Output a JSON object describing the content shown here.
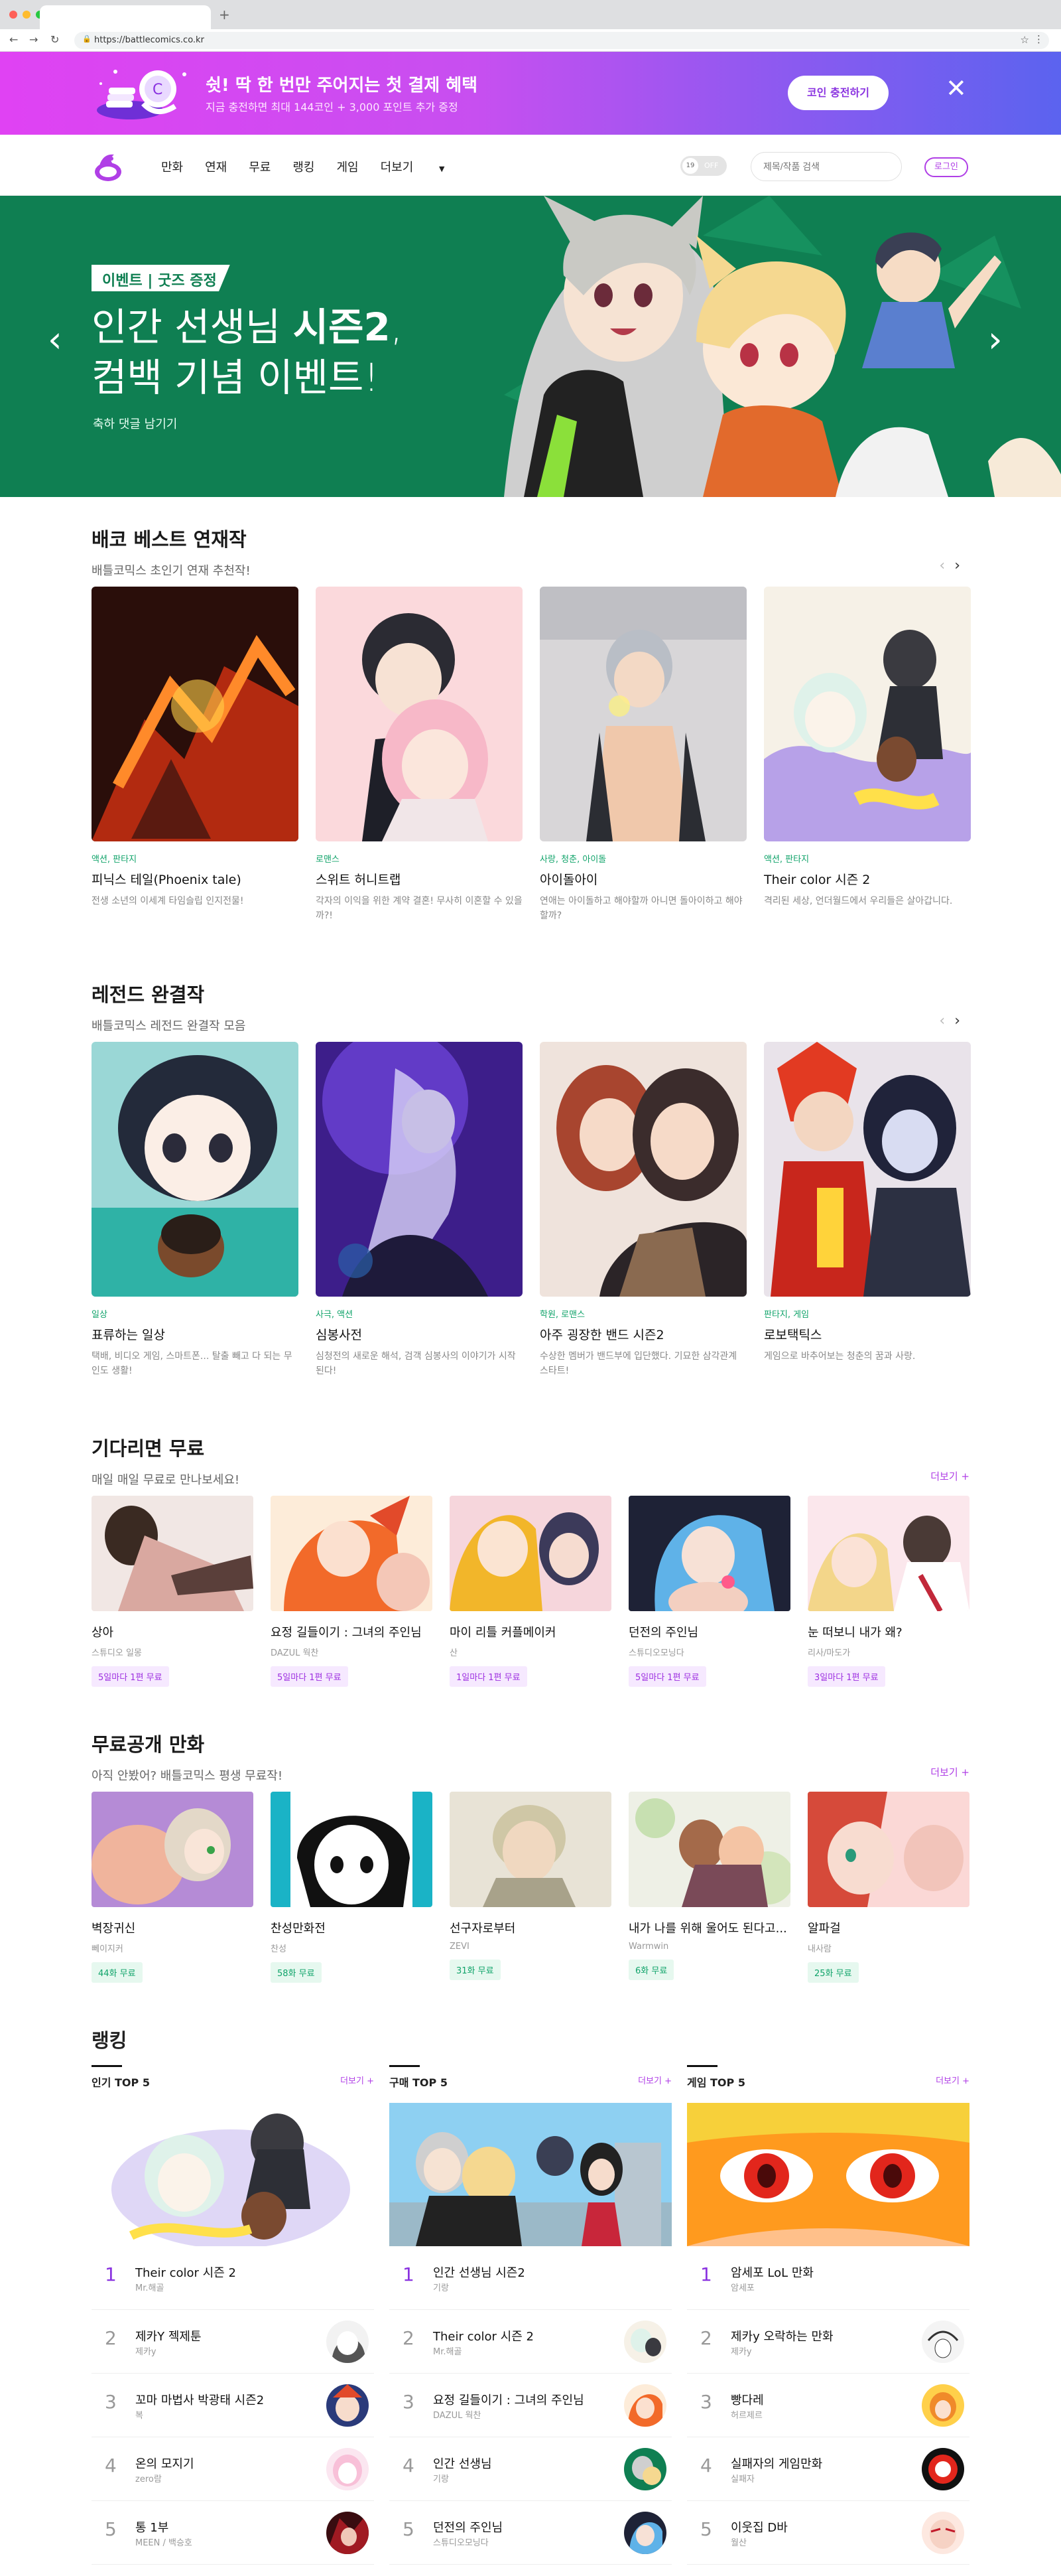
{
  "browser": {
    "url": "https://battlecomics.co.kr"
  },
  "promo": {
    "title": "쉿! 딱 한 번만 주어지는 첫 결제 혜택",
    "subtitle": "지금 충전하면 최대 144코인 + 3,000 포인트 추가 증정",
    "button": "코인 충전하기"
  },
  "gnb": {
    "menu": [
      "만화",
      "연재",
      "무료",
      "랭킹",
      "게임",
      "더보기"
    ],
    "toggle_label": "19",
    "toggle_state": "OFF",
    "search_placeholder": "제목/작품 검색",
    "login": "로그인"
  },
  "hero": {
    "tag": "이벤트 | 굿즈 증정",
    "title_line1_pre": "인간 선생님 ",
    "title_line1_bold": "시즌2",
    "title_line1_post": ",",
    "title_line2": "컴백 기념 이벤트!",
    "desc": "축하 댓글 남기기"
  },
  "best": {
    "title": "배코 베스트 연재작",
    "subtitle": "배틀코믹스 초인기 연재 추천작!",
    "items": [
      {
        "genre": "액션, 판타지",
        "title": "피닉스 테일(Phoenix tale)",
        "desc": "전생 소년의 이세계 타임슬립 인지전물!"
      },
      {
        "genre": "로맨스",
        "title": "스위트 허니트랩",
        "desc": "각자의 이익을 위한 계약 결혼! 무사히 이혼할 수 있을까?!"
      },
      {
        "genre": "사랑, 청춘, 아이돌",
        "title": "아이돌아이",
        "desc": "연애는 아이돌하고 해야할까 아니면 돌아이하고 해야할까?"
      },
      {
        "genre": "액션, 판타지",
        "title": "Their color 시즌 2",
        "desc": "격리된 세상, 언더월드에서 우리들은 살아갑니다."
      }
    ]
  },
  "legend": {
    "title": "레전드 완결작",
    "subtitle": "배틀코믹스 레전드 완결작 모음",
    "items": [
      {
        "genre": "일상",
        "title": "표류하는 일상",
        "desc": "택배, 비디오 게임, 스마트폰... 탈출 빼고 다 되는 무인도 생활!"
      },
      {
        "genre": "사극, 액션",
        "title": "심봉사전",
        "desc": "심청전의 새로운 해석, 검객 심봉사의 이야기가 시작된다!"
      },
      {
        "genre": "학원, 로맨스",
        "title": "아주 굉장한 밴드 시즌2",
        "desc": "수상한 멤버가 밴드부에 입단했다. 기묘한 삼각관계 스타트!"
      },
      {
        "genre": "판타지, 게임",
        "title": "로보택틱스",
        "desc": "게임으로 바추어보는 청춘의 꿈과 사랑."
      }
    ]
  },
  "waitfree": {
    "title": "기다리면 무료",
    "subtitle": "매일 매일 무료로 만나보세요!",
    "more": "더보기 +",
    "items": [
      {
        "title": "상아",
        "author": "스튜디오 일몽",
        "badge": "5일마다 1편 무료"
      },
      {
        "title": "요정 길들이기 : 그녀의 주인님",
        "author": "DAZUL 웍찬",
        "badge": "5일마다 1편 무료"
      },
      {
        "title": "마이 리틀 커플메이커",
        "author": "산",
        "badge": "1일마다 1편 무료"
      },
      {
        "title": "던전의 주인님",
        "author": "스튜디오모닝다",
        "badge": "5일마다 1편 무료"
      },
      {
        "title": "눈 떠보니 내가 왜?",
        "author": "리사/마도가",
        "badge": "3일마다 1편 무료"
      }
    ]
  },
  "free": {
    "title": "무료공개 만화",
    "subtitle": "아직 안봤어? 배틀코믹스 평생 무료작!",
    "more": "더보기 +",
    "items": [
      {
        "title": "벽장귀신",
        "author": "뻬이지커",
        "badge": "44화 무료"
      },
      {
        "title": "찬성만화전",
        "author": "찬성",
        "badge": "58화 무료"
      },
      {
        "title": "선구자로부터",
        "author": "ZEVI",
        "badge": "31화 무료"
      },
      {
        "title": "내가 나를 위해 울어도 된다고...",
        "author": "Warmwin",
        "badge": "6화 무료"
      },
      {
        "title": "알파걸",
        "author": "내사람",
        "badge": "25화 무료"
      }
    ]
  },
  "ranking": {
    "title": "랭킹",
    "columns": [
      {
        "head": "인기 TOP 5",
        "more": "더보기 +",
        "items": [
          {
            "n": "1",
            "title": "Their color 시즌 2",
            "author": "Mr.해골"
          },
          {
            "n": "2",
            "title": "제카Y 젝제툰",
            "author": "제카y"
          },
          {
            "n": "3",
            "title": "꼬마 마법사 박광태 시즌2",
            "author": "복"
          },
          {
            "n": "4",
            "title": "온의 모지기",
            "author": "zero람"
          },
          {
            "n": "5",
            "title": "통 1부",
            "author": "MEEN / 백승호"
          }
        ]
      },
      {
        "head": "구매 TOP 5",
        "more": "더보기 +",
        "items": [
          {
            "n": "1",
            "title": "인간 선생님 시즌2",
            "author": "기랑"
          },
          {
            "n": "2",
            "title": "Their color 시즌 2",
            "author": "Mr.해골"
          },
          {
            "n": "3",
            "title": "요정 길들이기 : 그녀의 주인님",
            "author": "DAZUL 웍찬"
          },
          {
            "n": "4",
            "title": "인간 선생님",
            "author": "기랑"
          },
          {
            "n": "5",
            "title": "던전의 주인님",
            "author": "스튜디오모닝다"
          }
        ]
      },
      {
        "head": "게임 TOP 5",
        "more": "더보기 +",
        "items": [
          {
            "n": "1",
            "title": "암세포 LoL 만화",
            "author": "암세포"
          },
          {
            "n": "2",
            "title": "제카y 오락하는 만화",
            "author": "제카y"
          },
          {
            "n": "3",
            "title": "빵다레",
            "author": "허르제르"
          },
          {
            "n": "4",
            "title": "실패자의 게임만화",
            "author": "실패자"
          },
          {
            "n": "5",
            "title": "이웃집 D바",
            "author": "월산"
          }
        ]
      }
    ]
  }
}
